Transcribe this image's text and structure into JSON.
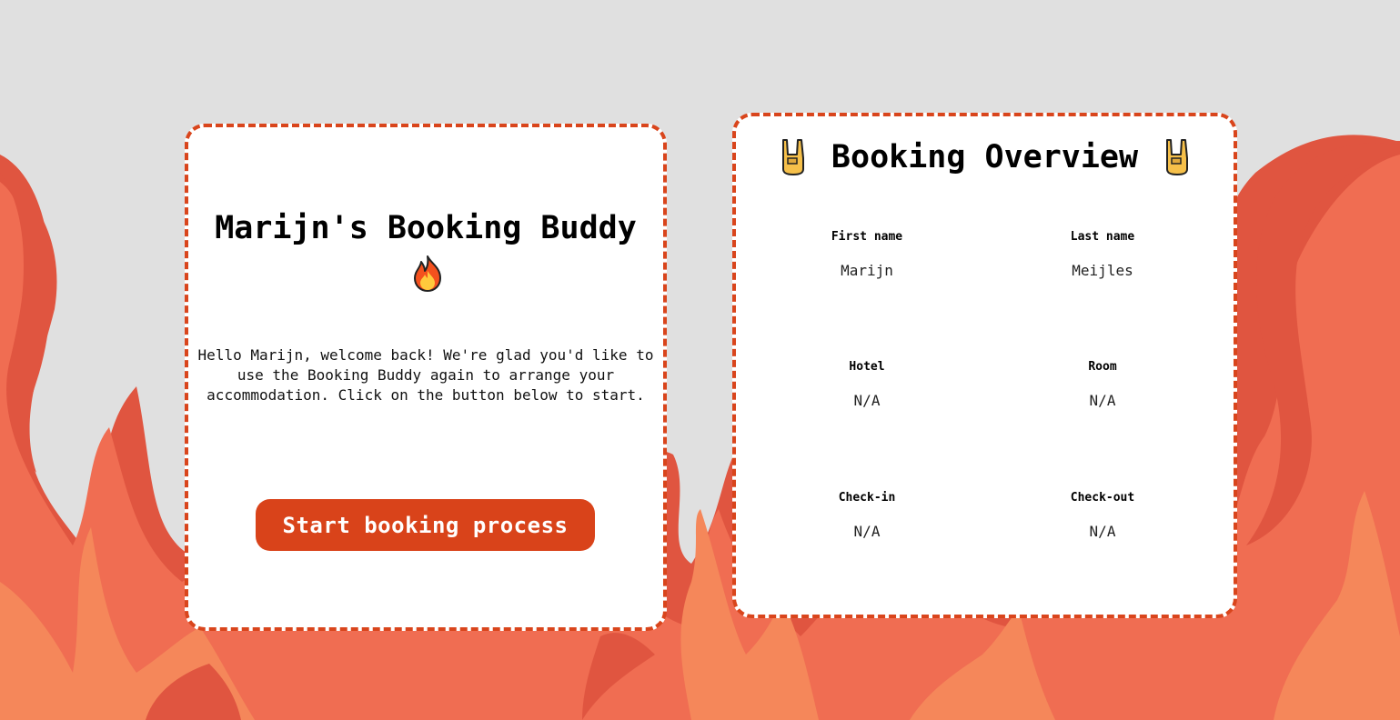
{
  "colors": {
    "background": "#e0e0e0",
    "accent": "#d9451c",
    "button": "#d9431a",
    "flame_dark": "#e05540",
    "flame_mid": "#f06d52",
    "flame_light": "#f5875a"
  },
  "welcome_card": {
    "title": "Marijn's Booking Buddy",
    "title_icon": "fire-emoji",
    "message": "Hello Marijn, welcome back! We're glad you'd like to use the Booking Buddy again to arrange your accommodation. Click on the button below to start.",
    "start_button_label": "Start booking process"
  },
  "overview_card": {
    "title": "Booking Overview",
    "title_icon": "rock-on-hand-emoji",
    "fields": {
      "first_name": {
        "label": "First name",
        "value": "Marijn"
      },
      "last_name": {
        "label": "Last name",
        "value": "Meijles"
      },
      "hotel": {
        "label": "Hotel",
        "value": "N/A"
      },
      "room": {
        "label": "Room",
        "value": "N/A"
      },
      "check_in": {
        "label": "Check-in",
        "value": "N/A"
      },
      "check_out": {
        "label": "Check-out",
        "value": "N/A"
      }
    }
  }
}
